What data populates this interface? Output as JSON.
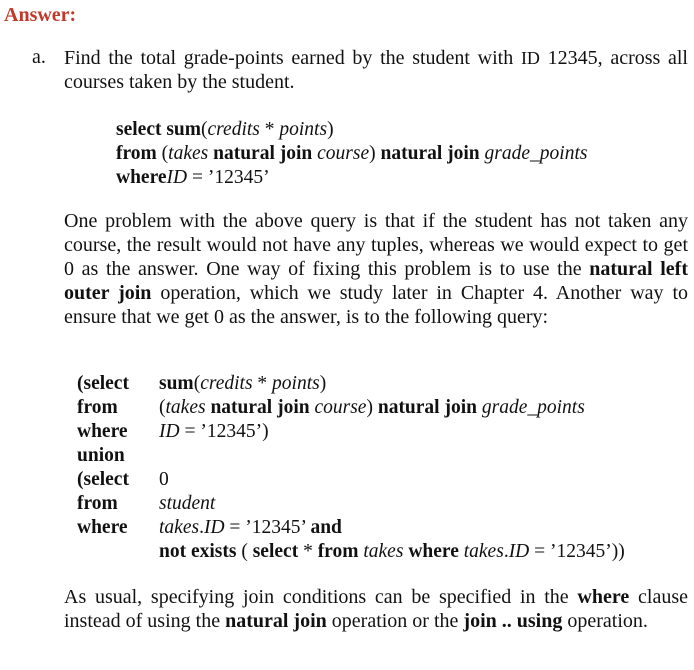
{
  "heading": "Answer:",
  "item": {
    "marker": "a.",
    "question": [
      {
        "t": "Find the total grade-points earned by the student with "
      },
      {
        "t": "ID",
        "sc": true
      },
      {
        "t": " 12345, across all courses taken by the student."
      }
    ]
  },
  "query1": [
    [
      {
        "t": "select ",
        "s": "b"
      },
      {
        "t": "sum",
        "s": "b"
      },
      {
        "t": "("
      },
      {
        "t": "credits",
        "s": "i"
      },
      {
        "t": " * "
      },
      {
        "t": "points",
        "s": "i"
      },
      {
        "t": ")"
      }
    ],
    [
      {
        "t": "from ",
        "s": "b"
      },
      {
        "t": " ("
      },
      {
        "t": "takes",
        "s": "i"
      },
      {
        "t": " "
      },
      {
        "t": "natural join",
        "s": "b"
      },
      {
        "t": " "
      },
      {
        "t": "course",
        "s": "i"
      },
      {
        "t": ") "
      },
      {
        "t": "natural join",
        "s": "b"
      },
      {
        "t": " "
      },
      {
        "t": "grade_points",
        "s": "i"
      }
    ],
    [
      {
        "t": "where",
        "s": "b"
      },
      {
        "t": "ID",
        "s": "i"
      },
      {
        "t": " = ’12345’"
      }
    ]
  ],
  "paragraph1": [
    {
      "t": "One problem with the above query is that if the student has not taken any course, the result would not have any tuples, whereas we would expect to get 0 as the answer. One way of fixing this problem is to use the "
    },
    {
      "t": "natural left outer join",
      "s": "b"
    },
    {
      "t": " operation, which we study later in Chapter 4. Another way to ensure that we get 0 as the answer, is to the following query:"
    }
  ],
  "query2": [
    {
      "kw": "(select",
      "body": [
        {
          "t": "sum",
          "s": "b"
        },
        {
          "t": "("
        },
        {
          "t": "credits",
          "s": "i"
        },
        {
          "t": " * "
        },
        {
          "t": "points",
          "s": "i"
        },
        {
          "t": ")"
        }
      ]
    },
    {
      "kw": "from",
      "body": [
        {
          "t": "("
        },
        {
          "t": "takes",
          "s": "i"
        },
        {
          "t": " "
        },
        {
          "t": "natural join",
          "s": "b"
        },
        {
          "t": " "
        },
        {
          "t": "course",
          "s": "i"
        },
        {
          "t": ") "
        },
        {
          "t": "natural join",
          "s": "b"
        },
        {
          "t": " "
        },
        {
          "t": "grade_points",
          "s": "i"
        }
      ]
    },
    {
      "kw": "where",
      "body": [
        {
          "t": "ID",
          "s": "i"
        },
        {
          "t": " = ’12345’)"
        }
      ]
    },
    {
      "kw": "union",
      "body": []
    },
    {
      "kw": "(select",
      "body": [
        {
          "t": "0"
        }
      ]
    },
    {
      "kw": "from",
      "body": [
        {
          "t": "student",
          "s": "i"
        }
      ]
    },
    {
      "kw": "where",
      "body": [
        {
          "t": "takes",
          "s": "i"
        },
        {
          "t": "."
        },
        {
          "t": "ID",
          "s": "i"
        },
        {
          "t": " = ’12345’ "
        },
        {
          "t": "and",
          "s": "b"
        }
      ]
    },
    {
      "kw": "",
      "body": [
        {
          "t": "not exists",
          "s": "b"
        },
        {
          "t": " ( "
        },
        {
          "t": "select",
          "s": "b"
        },
        {
          "t": " * "
        },
        {
          "t": "from",
          "s": "b"
        },
        {
          "t": " "
        },
        {
          "t": "takes",
          "s": "i"
        },
        {
          "t": " "
        },
        {
          "t": "where",
          "s": "b"
        },
        {
          "t": " "
        },
        {
          "t": "takes",
          "s": "i"
        },
        {
          "t": "."
        },
        {
          "t": "ID",
          "s": "i"
        },
        {
          "t": " = ’12345’))"
        }
      ]
    }
  ],
  "paragraph2": [
    {
      "t": "As usual, specifying join conditions can be specified in the "
    },
    {
      "t": "where",
      "s": "b"
    },
    {
      "t": " clause instead of using the "
    },
    {
      "t": "natural join",
      "s": "b"
    },
    {
      "t": " operation or the "
    },
    {
      "t": "join .. using",
      "s": "b"
    },
    {
      "t": " operation."
    }
  ],
  "colors": {
    "heading": "#c0392b",
    "text": "#111111"
  }
}
